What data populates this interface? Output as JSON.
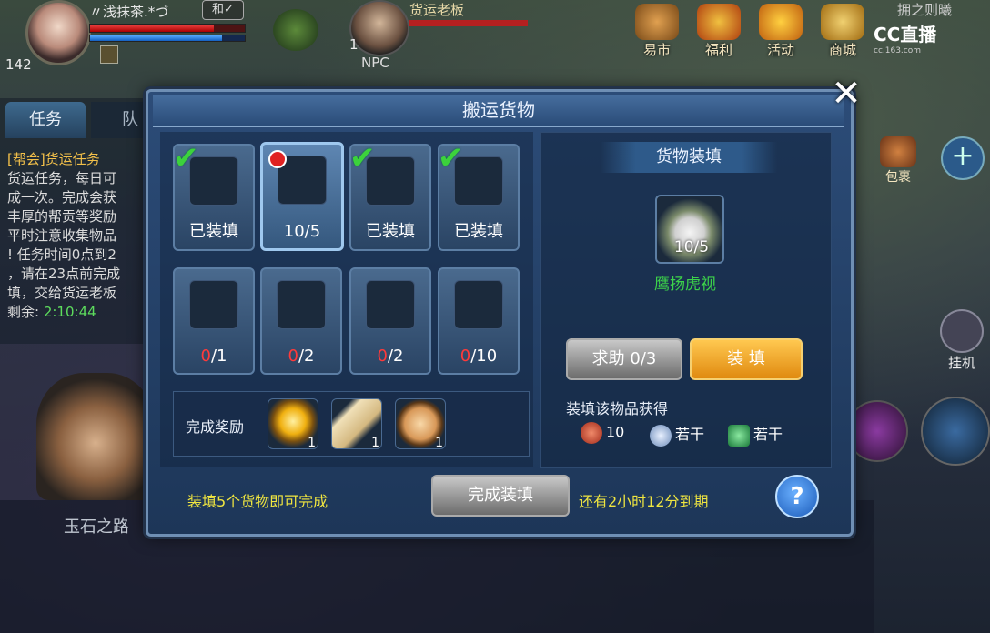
{
  "hud": {
    "player_name": "〃浅抹茶.*づ",
    "player_tag": "和✓",
    "player_level": "142",
    "hp_fraction": 0.8,
    "mp_fraction": 0.85,
    "npc_name": "货运老板",
    "npc_level": "1",
    "npc_label": "NPC"
  },
  "top_menu": [
    {
      "label": "易市",
      "icon": "market-icon"
    },
    {
      "label": "福利",
      "icon": "gift-icon"
    },
    {
      "label": "活动",
      "icon": "event-icon"
    },
    {
      "label": "商城",
      "icon": "shop-icon"
    }
  ],
  "overlay": {
    "cc_brand": "CC直播",
    "cc_domain": "cc.163.com",
    "top_right_text": "拥之则曦"
  },
  "right_side": {
    "bag_label": "包裹",
    "plus_label": "+",
    "auto_label": "挂机"
  },
  "task_panel": {
    "tab_task": "任务",
    "tab_team": "队",
    "lines": [
      "[帮会]货运任务",
      "货运任务，每日可",
      "成一次。完成会获",
      "丰厚的帮贡等奖励",
      "平时注意收集物品",
      "! 任务时间0点到2",
      "，请在23点前完成",
      "填，交给货运老板",
      "剩余: 2:10:44"
    ],
    "remaining_time": "2:10:44"
  },
  "chat": {
    "line": "玉石之路"
  },
  "dialog": {
    "title": "搬运货物",
    "close": "✕",
    "slots": [
      {
        "icon": "vase-icon",
        "label": "已装填",
        "checked": true
      },
      {
        "icon": "dish-icon",
        "label": "10/5",
        "checked": false,
        "selected": true
      },
      {
        "icon": "fish-icon",
        "label": "已装填",
        "checked": true
      },
      {
        "icon": "pot-icon",
        "label": "已装填",
        "checked": true
      },
      {
        "icon": "orb-icon",
        "have": "0",
        "need": "/1"
      },
      {
        "icon": "ruby-icon",
        "have": "0",
        "need": "/2"
      },
      {
        "icon": "amber-icon",
        "have": "0",
        "need": "/2"
      },
      {
        "icon": "plate-icon",
        "have": "0",
        "need": "/10"
      }
    ],
    "reward_label": "完成奖励",
    "rewards": [
      {
        "icon": "golden-orb-icon",
        "count": "1"
      },
      {
        "icon": "scroll-icon",
        "count": "1"
      },
      {
        "icon": "cake-icon",
        "count": "1"
      }
    ],
    "right": {
      "title": "货物装填",
      "item_count": "10/5",
      "item_name": "鹰扬虎视",
      "help_button": "求助 0/3",
      "load_button": "装 填",
      "gain_label": "装填该物品获得",
      "gains": [
        {
          "icon": "contribution-coin-icon",
          "value": "10"
        },
        {
          "icon": "silver-coin-icon",
          "value": "若干"
        },
        {
          "icon": "exp-icon",
          "value": "若干"
        }
      ]
    },
    "hint_left": "装填5个货物即可完成",
    "complete_button": "完成装填",
    "hint_right": "还有2小时12分到期",
    "question_button": "?"
  }
}
